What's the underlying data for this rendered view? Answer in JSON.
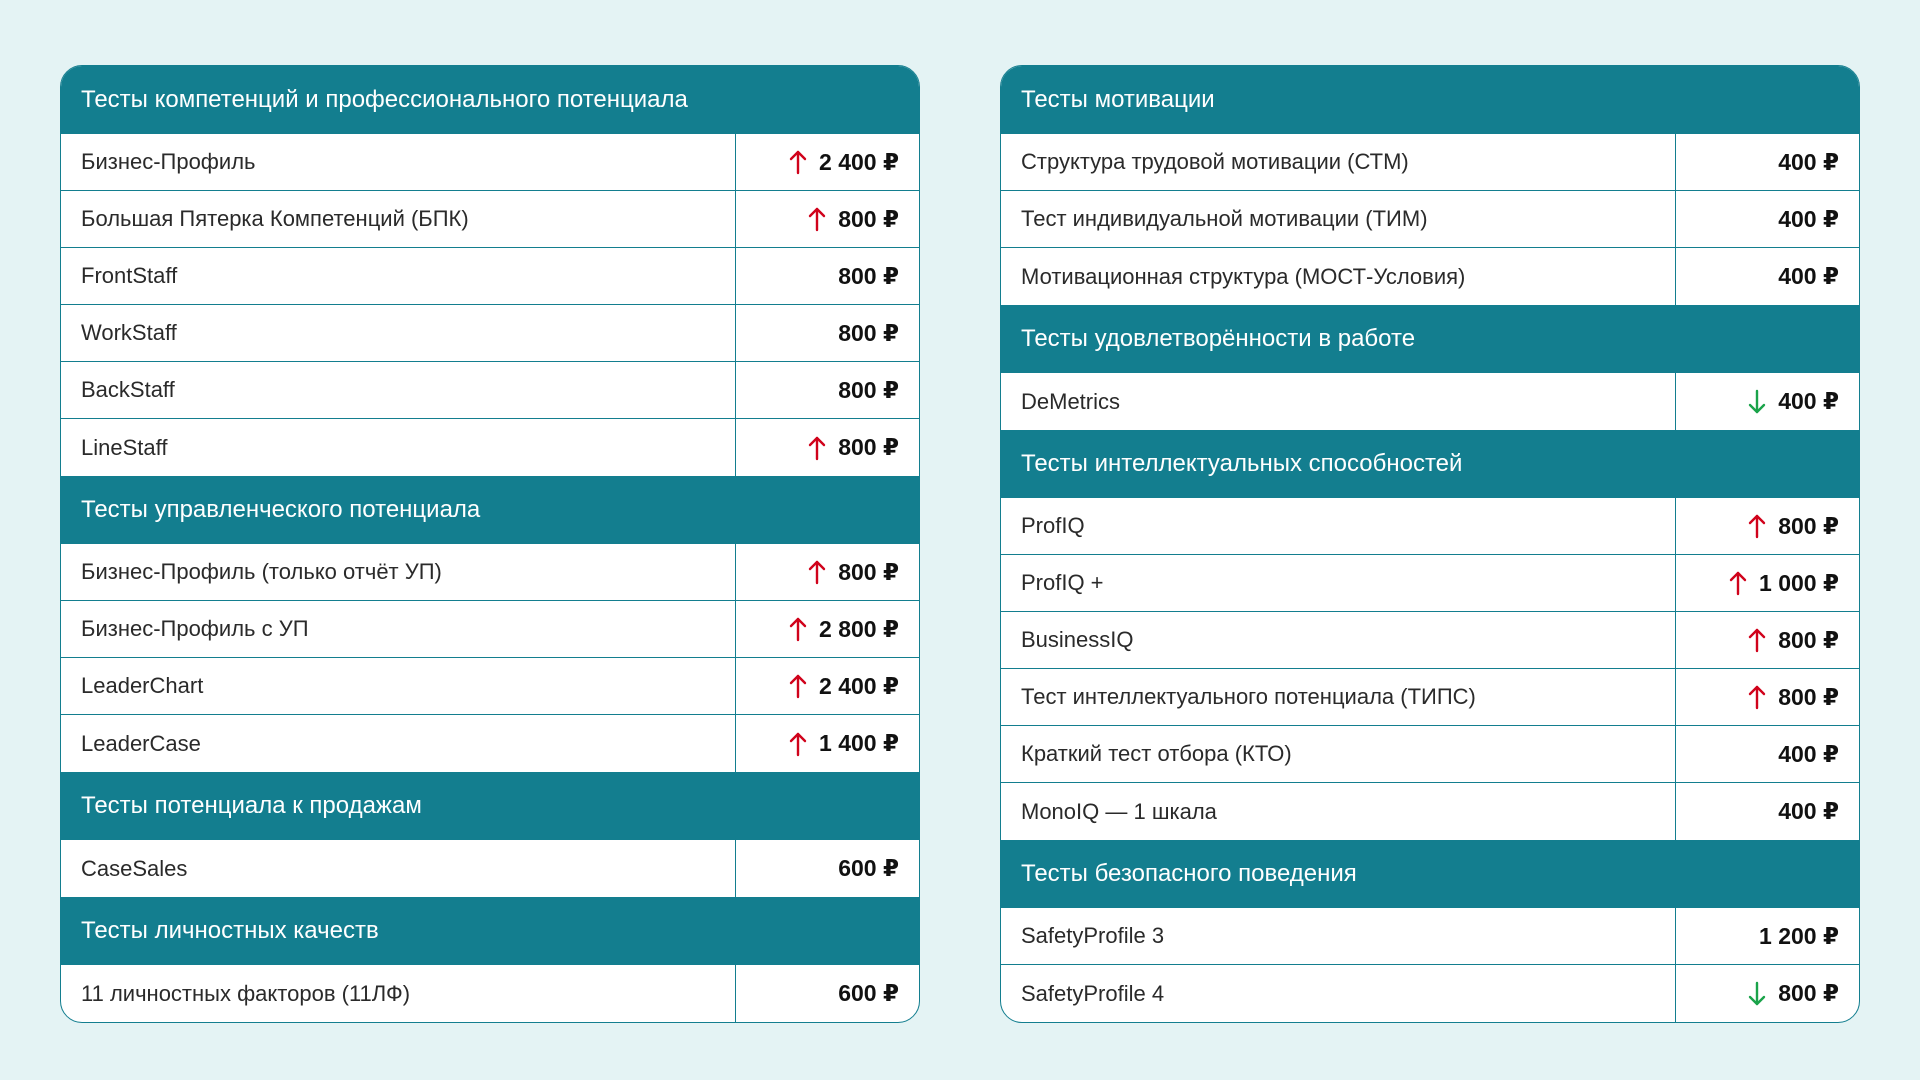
{
  "currency": "₽",
  "colors": {
    "background": "#e4f3f4",
    "header": "#137e8f",
    "arrow_up": "#d0021b",
    "arrow_down": "#1aa34a"
  },
  "left_panel": {
    "sections": [
      {
        "title": "Тесты компетенций и профессионального потенциала",
        "rows": [
          {
            "name": "Бизнес-Профиль",
            "price": "2 400 ₽",
            "trend": "up"
          },
          {
            "name": "Большая Пятерка Компетенций (БПК)",
            "price": "800 ₽",
            "trend": "up"
          },
          {
            "name": "FrontStaff",
            "price": "800 ₽",
            "trend": "none"
          },
          {
            "name": "WorkStaff",
            "price": "800 ₽",
            "trend": "none"
          },
          {
            "name": "BackStaff",
            "price": "800 ₽",
            "trend": "none"
          },
          {
            "name": "LineStaff",
            "price": "800 ₽",
            "trend": "up"
          }
        ]
      },
      {
        "title": "Тесты управленческого потенциала",
        "rows": [
          {
            "name": "Бизнес-Профиль (только отчёт УП)",
            "price": "800 ₽",
            "trend": "up"
          },
          {
            "name": "Бизнес-Профиль с УП",
            "price": "2 800 ₽",
            "trend": "up"
          },
          {
            "name": "LeaderChart",
            "price": "2 400 ₽",
            "trend": "up"
          },
          {
            "name": "LeaderCase",
            "price": "1 400 ₽",
            "trend": "up"
          }
        ]
      },
      {
        "title": "Тесты потенциала к продажам",
        "rows": [
          {
            "name": "CaseSales",
            "price": "600 ₽",
            "trend": "none"
          }
        ]
      },
      {
        "title": "Тесты личностных качеств",
        "rows": [
          {
            "name": "11 личностных факторов (11ЛФ)",
            "price": "600 ₽",
            "trend": "none"
          }
        ]
      }
    ]
  },
  "right_panel": {
    "sections": [
      {
        "title": "Тесты мотивации",
        "rows": [
          {
            "name": "Структура трудовой мотивации (СТМ)",
            "price": "400 ₽",
            "trend": "none"
          },
          {
            "name": "Тест индивидуальной мотивации (ТИМ)",
            "price": "400 ₽",
            "trend": "none"
          },
          {
            "name": "Мотивационная структура (МОСТ-Условия)",
            "price": "400 ₽",
            "trend": "none"
          }
        ]
      },
      {
        "title": "Тесты удовлетворённости в работе",
        "rows": [
          {
            "name": "DeMetrics",
            "price": "400 ₽",
            "trend": "down"
          }
        ]
      },
      {
        "title": "Тесты интеллектуальных способностей",
        "rows": [
          {
            "name": "ProfIQ",
            "price": "800 ₽",
            "trend": "up"
          },
          {
            "name": "ProfIQ +",
            "price": "1 000 ₽",
            "trend": "up"
          },
          {
            "name": "BusinessIQ",
            "price": "800 ₽",
            "trend": "up"
          },
          {
            "name": "Тест интеллектуального потенциала (ТИПС)",
            "price": "800 ₽",
            "trend": "up"
          },
          {
            "name": "Краткий тест отбора (КТО)",
            "price": "400 ₽",
            "trend": "none"
          },
          {
            "name": "MonoIQ — 1 шкала",
            "price": "400 ₽",
            "trend": "none"
          }
        ]
      },
      {
        "title": "Тесты безопасного поведения",
        "rows": [
          {
            "name": "SafetyProfile 3",
            "price": "1 200 ₽",
            "trend": "none"
          },
          {
            "name": "SafetyProfile 4",
            "price": "800 ₽",
            "trend": "down"
          }
        ]
      }
    ]
  }
}
